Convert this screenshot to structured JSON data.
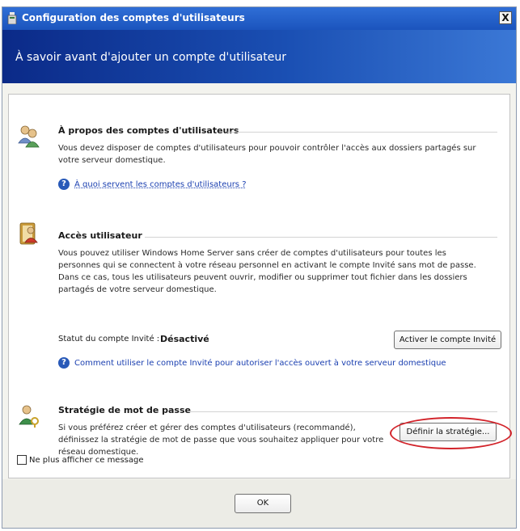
{
  "window": {
    "title": "Configuration des comptes d'utilisateurs",
    "close_glyph": "X"
  },
  "header": {
    "heading": "À savoir avant d'ajouter un compte d'utilisateur"
  },
  "sections": {
    "about": {
      "icon": "users-icon",
      "title": "À propos des comptes d'utilisateurs",
      "text": "Vous devez disposer de comptes d'utilisateurs pour pouvoir contrôler l'accès aux dossiers partagés sur votre serveur domestique.",
      "help_link": "À quoi servent les comptes d'utilisateurs ?"
    },
    "access": {
      "icon": "user-access-icon",
      "title": "Accès utilisateur",
      "text": "Vous pouvez utiliser Windows Home Server sans créer de comptes d'utilisateurs pour toutes les personnes qui se connectent à votre réseau personnel en activant le compte Invité sans mot de passe. Dans ce cas, tous les utilisateurs peuvent ouvrir, modifier ou supprimer tout fichier dans les dossiers partagés de votre serveur domestique.",
      "status_label": "Statut du compte Invité :",
      "status_value": "Désactivé",
      "activate_button": "Activer le compte Invité",
      "help_link": "Comment utiliser le compte Invité pour autoriser l'accès ouvert à votre serveur domestique"
    },
    "password": {
      "icon": "password-policy-icon",
      "title": "Stratégie de mot de passe",
      "text": "Si vous préférez créer et gérer des comptes d'utilisateurs (recommandé), définissez la stratégie de mot de passe que vous souhaitez appliquer pour votre réseau domestique.",
      "define_button": "Définir la stratégie..."
    }
  },
  "checkbox": {
    "label": "Ne plus afficher ce message",
    "checked": false
  },
  "footer": {
    "ok_button": "OK"
  },
  "colors": {
    "title_bar": "#1b54bd",
    "header_band_start": "#0b2a88",
    "header_band_end": "#3b78d6",
    "link": "#1a3fb0",
    "highlight_ring": "#d2232a"
  }
}
